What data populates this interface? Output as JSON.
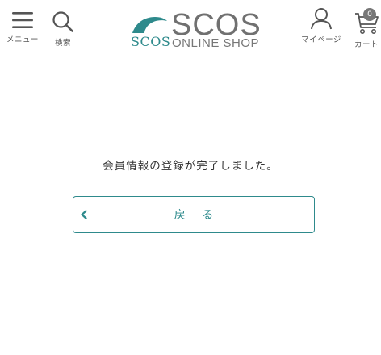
{
  "header": {
    "menu_label": "メニュー",
    "search_label": "検索",
    "mypage_label": "マイページ",
    "cart_label": "カート",
    "cart_count": "0",
    "logo": {
      "main": "SCOS",
      "sub": "SCOS",
      "tagline": "ONLINE SHOP"
    }
  },
  "main": {
    "message": "会員情報の登録が完了しました。",
    "back_button_label": "戻 る"
  },
  "colors": {
    "accent": "#2e8a8c",
    "text": "#333333",
    "icon": "#555555"
  },
  "icons": [
    "hamburger-icon",
    "search-icon",
    "user-icon",
    "cart-icon",
    "chevron-left-icon"
  ]
}
